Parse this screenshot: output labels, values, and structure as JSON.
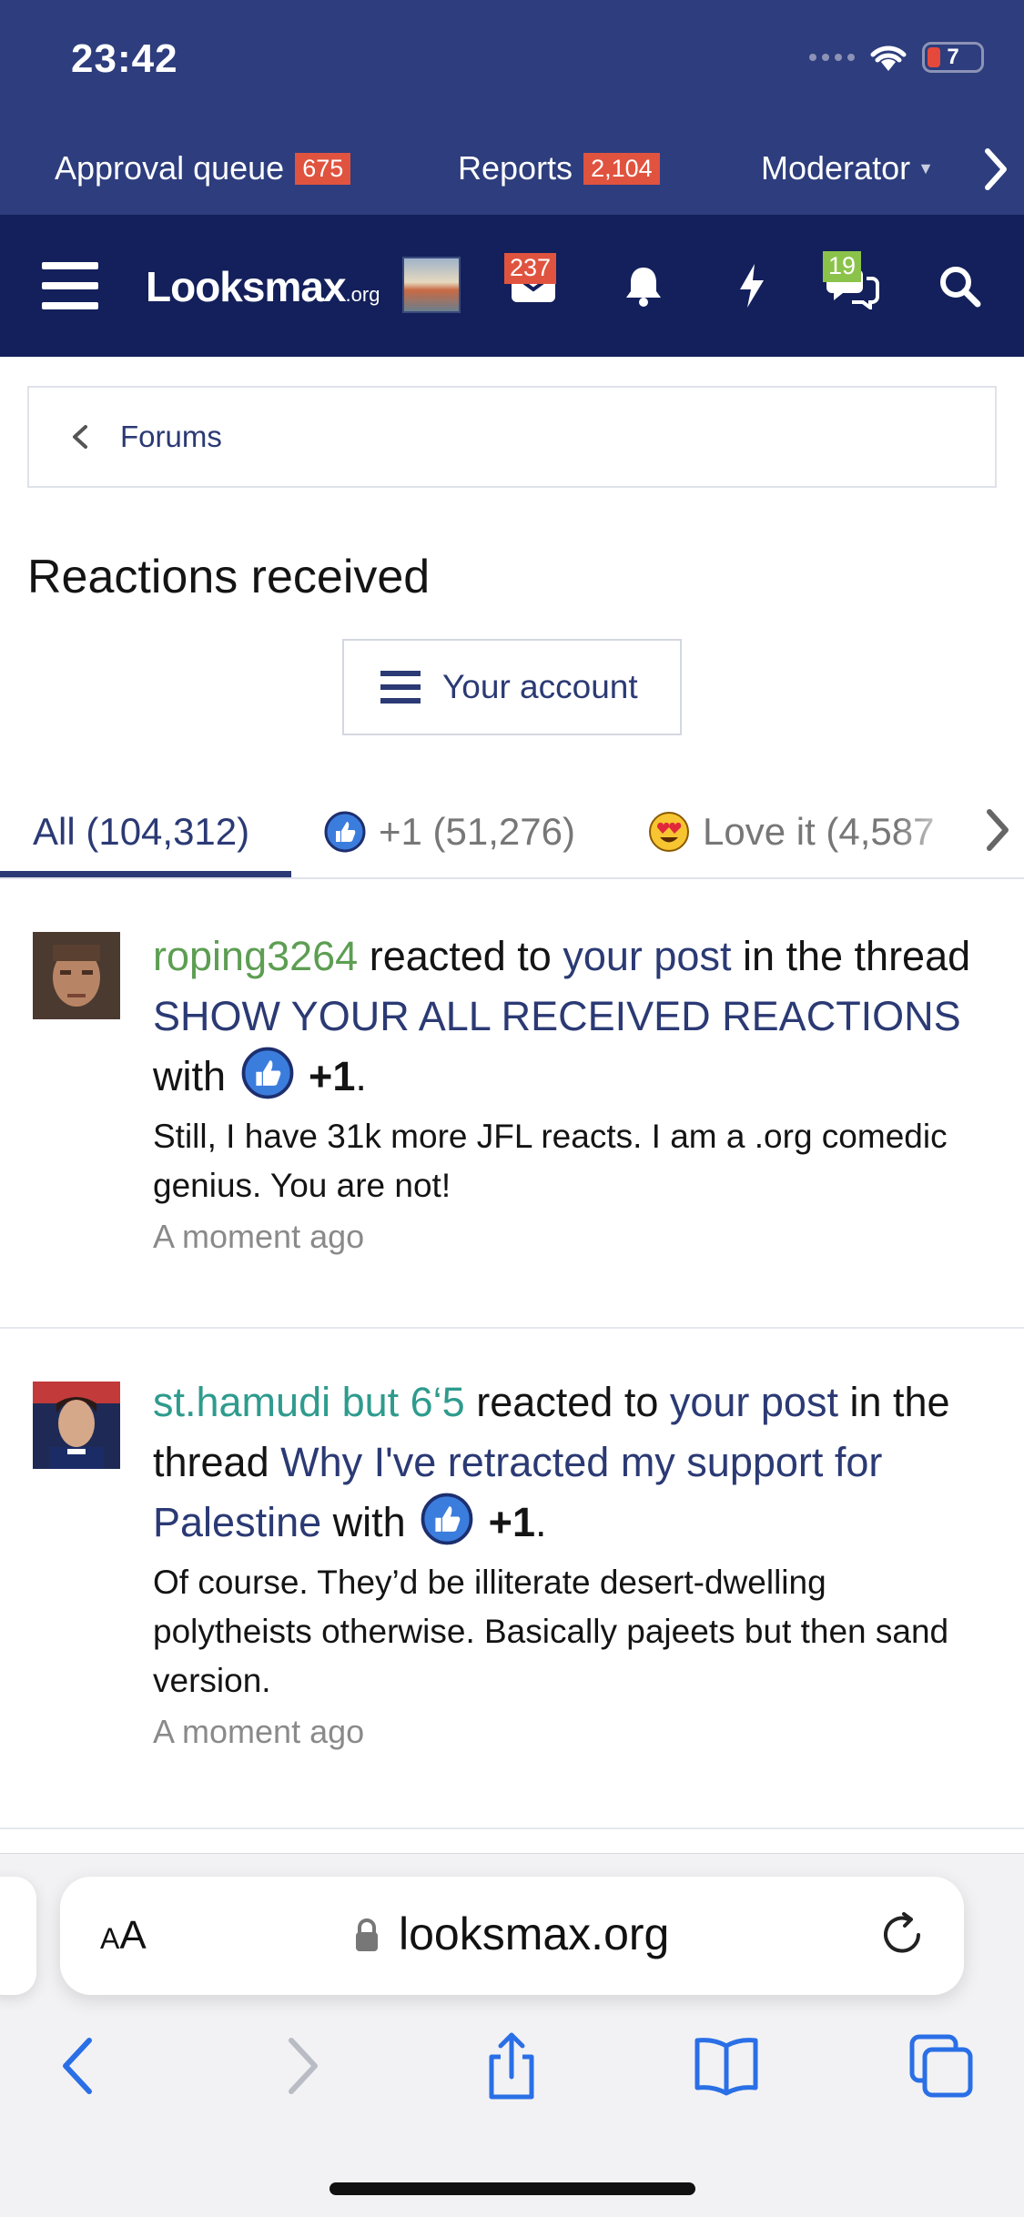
{
  "status_bar": {
    "time": "23:42",
    "battery": "7"
  },
  "moderator_bar": {
    "items": [
      {
        "label": "Approval queue",
        "badge": "675"
      },
      {
        "label": "Reports",
        "badge": "2,104"
      },
      {
        "label": "Moderator"
      }
    ]
  },
  "nav": {
    "logo_text": "Looksmax",
    "logo_suffix": ".org",
    "inbox_badge": "237",
    "alerts_badge": "19",
    "icons": [
      "menu-icon",
      "avatar",
      "inbox-icon",
      "bell-icon",
      "lightning-icon",
      "chat-icon",
      "search-icon"
    ],
    "colors": {
      "top": "#2d3d7d",
      "nav": "#13205b",
      "badge_red": "#e0533f",
      "badge_green": "#8bc34a"
    }
  },
  "breadcrumb": {
    "label": "Forums"
  },
  "page": {
    "title": "Reactions received",
    "account_button": "Your account"
  },
  "tabs": [
    {
      "label": "All (104,312)",
      "active": true
    },
    {
      "label": "+1 (51,276)",
      "icon": "thumbs-up-icon"
    },
    {
      "label": "Love it (4,587",
      "icon": "heart-eyes-icon"
    }
  ],
  "feed": [
    {
      "user": "roping3264",
      "text_reacted": " reacted to ",
      "post_link": "your post",
      "text_in_thread": " in the thread ",
      "thread": "SHOW YOUR ALL RECEIVED REACTIONS",
      "text_with": " with ",
      "reaction": "+1",
      "snippet": "Still, I have 31k more JFL reacts. I am a .org comedic genius. You are not!",
      "time": "A moment ago"
    },
    {
      "user": "st.hamudi but 6‘5",
      "text_reacted": " reacted to ",
      "post_link": "your post",
      "text_in_thread": " in the thread ",
      "thread": "Why I've retracted my support for Palestine",
      "text_with": " with ",
      "reaction": "+1",
      "snippet": "Of course. They’d be illiterate desert-dwelling polytheists otherwise. Basically pajeets but then sand version.",
      "time": "A moment ago"
    }
  ],
  "browser": {
    "aa_small": "A",
    "aa_large": "A",
    "url": "looksmax.org"
  }
}
